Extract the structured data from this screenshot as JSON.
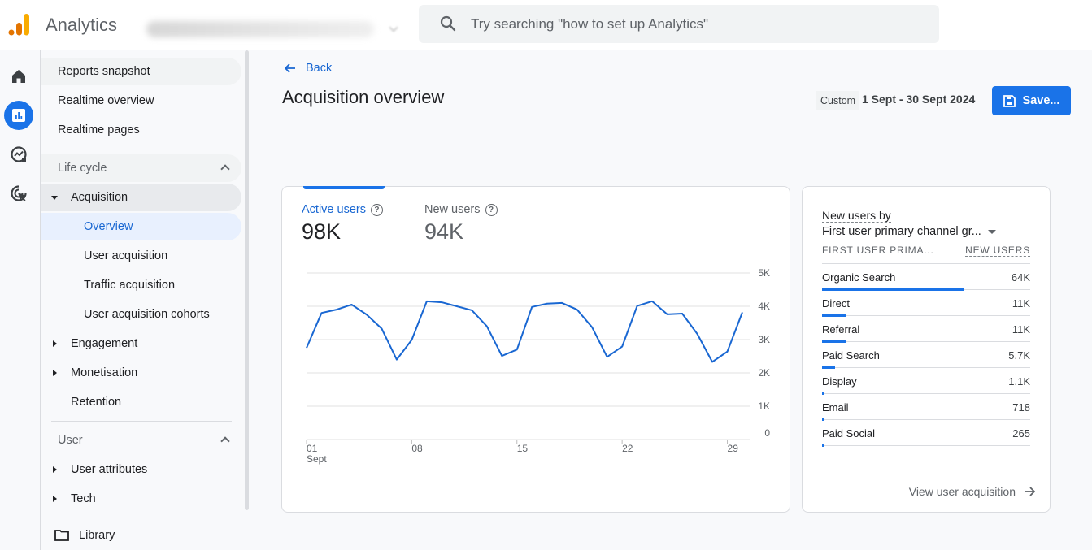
{
  "header": {
    "app_title": "Analytics",
    "search_placeholder": "Try searching \"how to set up Analytics\"",
    "logo_colors": [
      "#e37400",
      "#f9ab00"
    ]
  },
  "rail": [
    {
      "name": "home",
      "icon": "home-icon"
    },
    {
      "name": "reports",
      "icon": "reports-icon",
      "active": true
    },
    {
      "name": "explore",
      "icon": "explore-icon"
    },
    {
      "name": "advertising",
      "icon": "advertising-icon"
    }
  ],
  "nav": {
    "top_items": [
      "Reports snapshot",
      "Realtime overview",
      "Realtime pages"
    ],
    "lifecycle": {
      "label": "Life cycle",
      "acquisition": "Acquisition",
      "acquisition_children": [
        "Overview",
        "User acquisition",
        "Traffic acquisition",
        "User acquisition cohorts"
      ],
      "selected": "Overview",
      "others": [
        "Engagement",
        "Monetisation",
        "Retention"
      ]
    },
    "user": {
      "label": "User",
      "items": [
        "User attributes",
        "Tech"
      ]
    },
    "library": "Library"
  },
  "page": {
    "back_label": "Back",
    "title": "Acquisition overview",
    "date_preset": "Custom",
    "date_range": "1 Sept - 30 Sept 2024",
    "save_label": "Save..."
  },
  "metrics": [
    {
      "label": "Active users",
      "value": "98K",
      "active": true
    },
    {
      "label": "New users",
      "value": "94K",
      "active": false
    }
  ],
  "chart_data": {
    "type": "line",
    "title": "",
    "series": [
      {
        "name": "Active users",
        "color": "#1967d2",
        "values": [
          2750,
          3800,
          3900,
          4050,
          3750,
          3330,
          2400,
          2990,
          4150,
          4120,
          4000,
          3880,
          3400,
          2510,
          2700,
          3980,
          4080,
          4100,
          3900,
          3370,
          2480,
          2790,
          4010,
          4150,
          3760,
          3780,
          3170,
          2330,
          2640,
          3820
        ]
      }
    ],
    "x": [
      1,
      2,
      3,
      4,
      5,
      6,
      7,
      8,
      9,
      10,
      11,
      12,
      13,
      14,
      15,
      16,
      17,
      18,
      19,
      20,
      21,
      22,
      23,
      24,
      25,
      26,
      27,
      28,
      29,
      30
    ],
    "x_tick_labels": [
      {
        "day": 1,
        "label": "01",
        "sub": "Sept"
      },
      {
        "day": 8,
        "label": "08"
      },
      {
        "day": 15,
        "label": "15"
      },
      {
        "day": 22,
        "label": "22"
      },
      {
        "day": 29,
        "label": "29"
      }
    ],
    "y_tick_labels": [
      "0",
      "1K",
      "2K",
      "3K",
      "4K",
      "5K"
    ],
    "y_ticks": [
      0,
      1000,
      2000,
      3000,
      4000,
      5000
    ],
    "ylim": [
      0,
      5000
    ],
    "grid": true,
    "y_axis_side": "right"
  },
  "side_card": {
    "title": "New users by",
    "dimension": "First user primary channel gr...",
    "col_dim": "FIRST USER PRIMA...",
    "col_metric": "NEW USERS",
    "rows": [
      {
        "label": "Organic Search",
        "value": "64K",
        "num": 64000
      },
      {
        "label": "Direct",
        "value": "11K",
        "num": 11000
      },
      {
        "label": "Referral",
        "value": "11K",
        "num": 10600
      },
      {
        "label": "Paid Search",
        "value": "5.7K",
        "num": 5700
      },
      {
        "label": "Display",
        "value": "1.1K",
        "num": 1100
      },
      {
        "label": "Email",
        "value": "718",
        "num": 718
      },
      {
        "label": "Paid Social",
        "value": "265",
        "num": 265
      }
    ],
    "max_value": 94000,
    "link_label": "View user acquisition"
  }
}
